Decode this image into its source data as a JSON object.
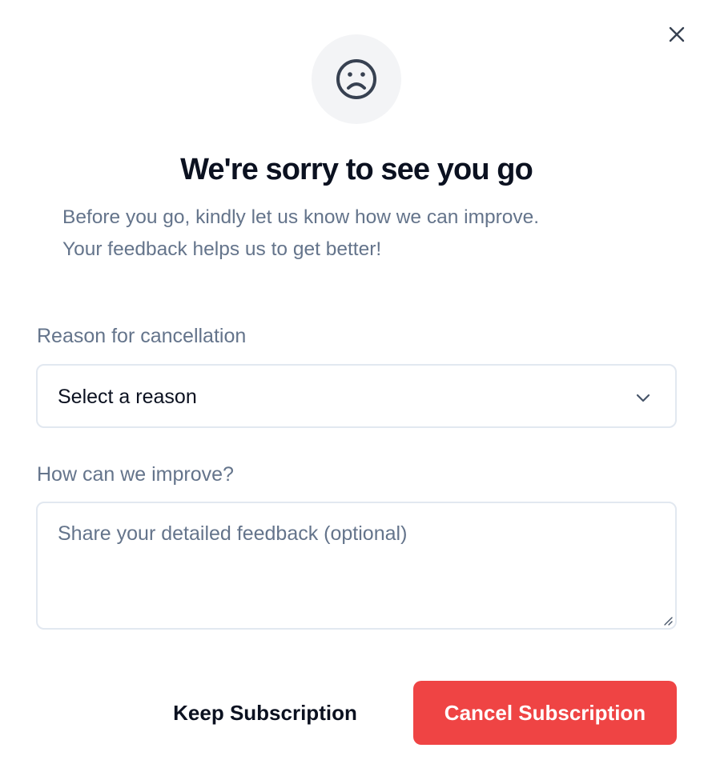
{
  "dialog": {
    "title": "We're sorry to see you go",
    "subtitle_line1": "Before you go, kindly let us know how we can improve.",
    "subtitle_line2": "Your feedback helps us to get better!",
    "header_icon": "sad-face-icon",
    "close_icon": "close-icon"
  },
  "form": {
    "reason": {
      "label": "Reason for cancellation",
      "selected": "Select a reason",
      "icon": "chevron-down-icon"
    },
    "feedback": {
      "label": "How can we improve?",
      "placeholder": "Share your detailed feedback (optional)",
      "value": ""
    }
  },
  "actions": {
    "keep_label": "Keep Subscription",
    "cancel_label": "Cancel Subscription"
  },
  "colors": {
    "danger": "#ef4444",
    "muted_text": "#64748b",
    "border": "#e2e8f0",
    "icon_bg": "#f3f4f6"
  }
}
